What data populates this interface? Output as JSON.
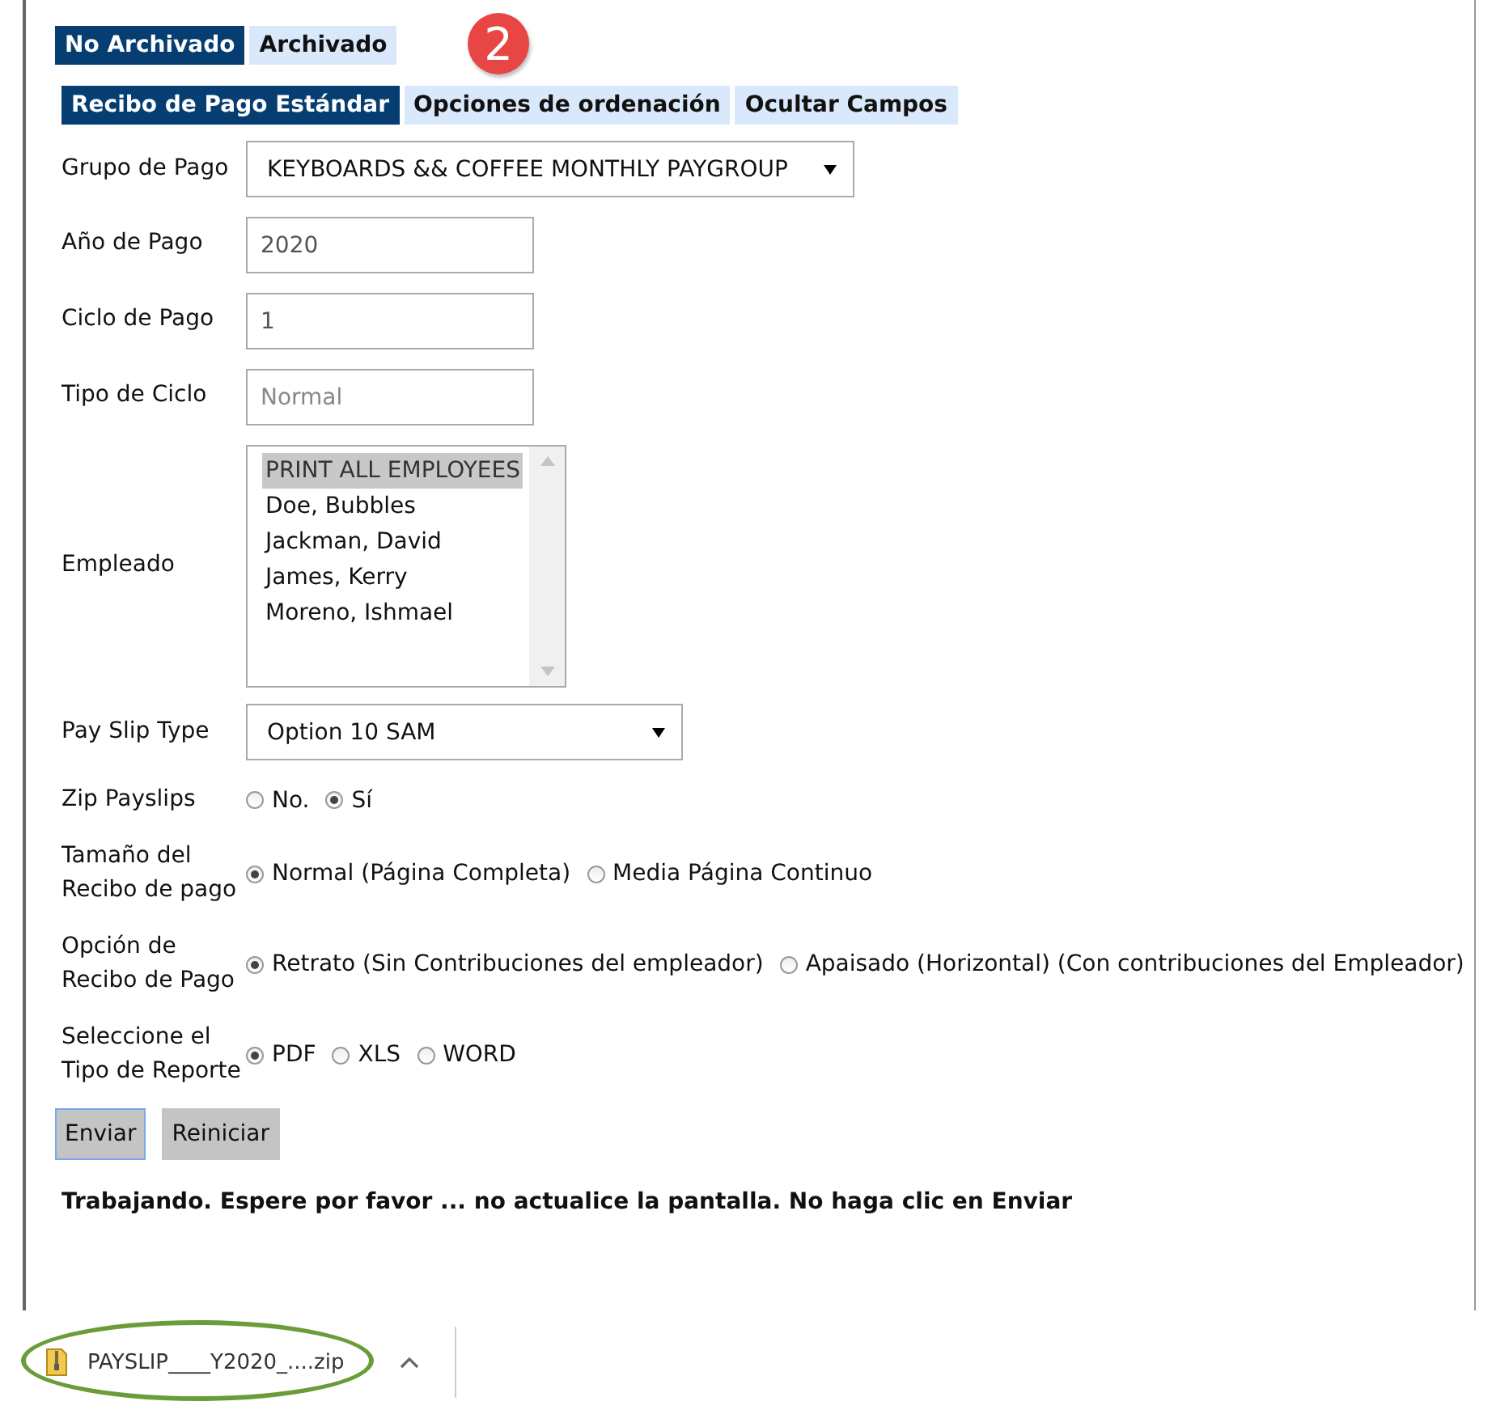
{
  "archive_tabs": [
    {
      "label": "No Archivado",
      "selected": true
    },
    {
      "label": "Archivado",
      "selected": false
    }
  ],
  "callout": "2",
  "form_tabs": [
    {
      "label": "Recibo de Pago Estándar",
      "selected": true
    },
    {
      "label": "Opciones de ordenación",
      "selected": false
    },
    {
      "label": "Ocultar Campos",
      "selected": false
    }
  ],
  "fields": [
    {
      "kind": "select",
      "label": "Grupo de Pago",
      "value": "KEYBOARDS && COFFEE MONTHLY PAYGROUP",
      "wide": true
    },
    {
      "kind": "text",
      "label": "Año de Pago",
      "value": "2020"
    },
    {
      "kind": "text",
      "label": "Ciclo de Pago",
      "value": "1"
    },
    {
      "kind": "text",
      "label": "Tipo de Ciclo",
      "placeholder": "Normal"
    },
    {
      "kind": "listbox",
      "label": "Empleado",
      "items": [
        {
          "label": "PRINT ALL EMPLOYEES",
          "selected": true
        },
        {
          "label": "Doe, Bubbles",
          "selected": false
        },
        {
          "label": "Jackman, David",
          "selected": false
        },
        {
          "label": "James, Kerry",
          "selected": false
        },
        {
          "label": "Moreno, Ishmael",
          "selected": false
        }
      ]
    },
    {
      "kind": "select",
      "label": "Pay Slip Type",
      "value": "Option 10 SAM",
      "wide": false
    },
    {
      "kind": "radio",
      "label": "Zip Payslips",
      "options": [
        {
          "label": "No.",
          "selected": false
        },
        {
          "label": "Sí",
          "selected": true
        }
      ]
    },
    {
      "kind": "radio",
      "label": "Tamaño del Recibo de pago",
      "options": [
        {
          "label": "Normal (Página Completa)",
          "selected": true
        },
        {
          "label": "Media Página Continuo",
          "selected": false
        }
      ]
    },
    {
      "kind": "radio",
      "label": "Opción de Recibo de Pago",
      "options": [
        {
          "label": "Retrato (Sin Contribuciones del empleador)",
          "selected": true
        },
        {
          "label": "Apaisado (Horizontal) (Con contribuciones del Empleador)",
          "selected": false
        }
      ]
    },
    {
      "kind": "radio",
      "label": "Seleccione el Tipo de Reporte",
      "options": [
        {
          "label": "PDF",
          "selected": true
        },
        {
          "label": "XLS",
          "selected": false
        },
        {
          "label": "WORD",
          "selected": false
        }
      ]
    }
  ],
  "buttons": [
    {
      "label": "Enviar",
      "focused": true
    },
    {
      "label": "Reiniciar",
      "focused": false
    }
  ],
  "status_message": "Trabajando. Espere por favor ... no actualice la pantalla. No haga clic en Enviar",
  "download": {
    "filename": "PAYSLIP____Y2020_....zip"
  }
}
